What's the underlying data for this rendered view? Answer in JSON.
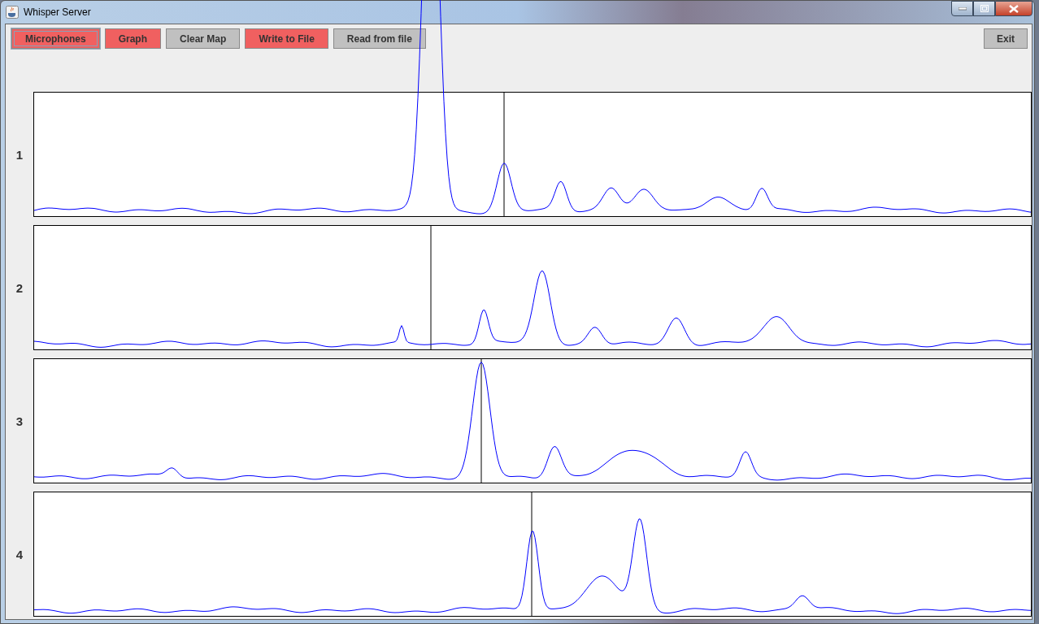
{
  "window": {
    "title": "Whisper Server"
  },
  "toolbar": [
    {
      "label": "Microphones",
      "on": true,
      "focused": true
    },
    {
      "label": "Graph",
      "on": true,
      "focused": false
    },
    {
      "label": "Clear Map",
      "on": false,
      "focused": false
    },
    {
      "label": "Write to File",
      "on": true,
      "focused": false
    },
    {
      "label": "Read from file",
      "on": false,
      "focused": false
    }
  ],
  "exit_button": {
    "label": "Exit"
  },
  "channels": [
    {
      "label": "1"
    },
    {
      "label": "2"
    },
    {
      "label": "3"
    },
    {
      "label": "4"
    }
  ]
}
